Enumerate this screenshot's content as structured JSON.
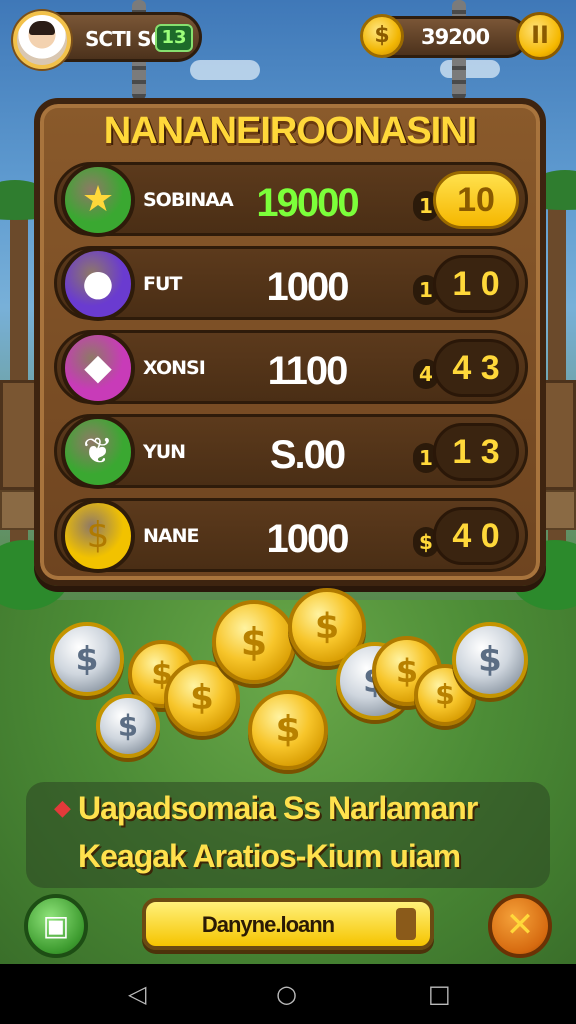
{
  "top_bar": {
    "player_name": "SCTI SO",
    "player_level": "13",
    "coin_amount": "39200",
    "pause_glyph": "II",
    "coin_icon": "coin-icon"
  },
  "board": {
    "title": "NANANEIROONASINI",
    "rows": [
      {
        "icon": "star-icon",
        "icon_glyph": "★",
        "icon_color": "#3aa831",
        "label": "SOBINAA",
        "value": "19000",
        "qty": "1",
        "button": "10",
        "value_color": "#7cff3a",
        "button_style": "gold"
      },
      {
        "icon": "cherry-icon",
        "icon_glyph": "●",
        "icon_color": "#6a3bd0",
        "label": "FUT",
        "value": "1000",
        "qty": "1",
        "button": "1 0",
        "value_color": "#ffffff",
        "button_style": "dark"
      },
      {
        "icon": "gem-icon",
        "icon_glyph": "◆",
        "icon_color": "#c83bb8",
        "label": "XONSI",
        "value": "1100",
        "qty": "4",
        "button": "4 3",
        "value_color": "#ffffff",
        "button_style": "dark"
      },
      {
        "icon": "leaf-icon",
        "icon_glyph": "❦",
        "icon_color": "#3aa831",
        "label": "YUN",
        "value": "S.00",
        "qty": "1",
        "button": "1 3",
        "value_color": "#ffffff",
        "button_style": "dark"
      },
      {
        "icon": "dollar-coin-icon",
        "icon_glyph": "$",
        "icon_color": "#f2c200",
        "label": "NANE",
        "value": "1000",
        "qty": "$",
        "button": "4 0",
        "value_color": "#ffffff",
        "button_style": "dark"
      }
    ]
  },
  "banner": {
    "line1": "Uapadsomaia Ss Narlamanr",
    "line2": "Keagak Aratios-Kium uiam"
  },
  "bottom": {
    "action_label": "Danyne.loann",
    "close_glyph": "✕",
    "bag_glyph": "▣"
  },
  "nav": {
    "back": "◁",
    "home": "○",
    "recents": "□"
  }
}
